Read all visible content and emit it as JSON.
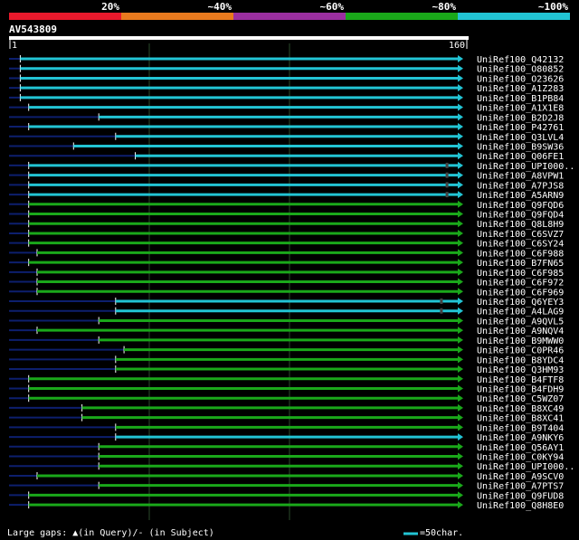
{
  "legend": {
    "bands": [
      {
        "label": "20%",
        "color": "#e8192c"
      },
      {
        "label": "~40%",
        "color": "#e87a1e"
      },
      {
        "label": "~60%",
        "color": "#9b2fa0"
      },
      {
        "label": "~80%",
        "color": "#1aa81a"
      },
      {
        "label": "~100%",
        "color": "#22c4d4"
      }
    ]
  },
  "footer": {
    "gaps_text": "Large gaps: ▲(in Query)/- (in Subject)",
    "scale_text": "=50char."
  },
  "chart_data": {
    "type": "alignment",
    "query_name": "AV543809",
    "query_start": "1",
    "query_end": "160",
    "query_length": 160,
    "colors": {
      "cyan": "#22c4d4",
      "green": "#1aa81a",
      "prefix": "#0d1f6e",
      "grid": "#2a4a2a"
    },
    "hits": [
      {
        "name": "UniRef100_Q42132",
        "start": 4,
        "end": 160,
        "identity": "~100%",
        "gaps": []
      },
      {
        "name": "UniRef100_O80852",
        "start": 4,
        "end": 160,
        "identity": "~100%",
        "gaps": []
      },
      {
        "name": "UniRef100_O23626",
        "start": 4,
        "end": 160,
        "identity": "~100%",
        "gaps": []
      },
      {
        "name": "UniRef100_A1Z283",
        "start": 4,
        "end": 160,
        "identity": "~100%",
        "gaps": []
      },
      {
        "name": "UniRef100_B1PB84",
        "start": 4,
        "end": 160,
        "identity": "~100%",
        "gaps": []
      },
      {
        "name": "UniRef100_A1X1E8",
        "start": 7,
        "end": 160,
        "identity": "~100%",
        "gaps": []
      },
      {
        "name": "UniRef100_B2D2J8",
        "start": 32,
        "end": 160,
        "identity": "~100%",
        "gaps": []
      },
      {
        "name": "UniRef100_P42761",
        "start": 7,
        "end": 160,
        "identity": "~100%",
        "gaps": []
      },
      {
        "name": "UniRef100_Q3LVL4",
        "start": 38,
        "end": 160,
        "identity": "~100%",
        "gaps": []
      },
      {
        "name": "UniRef100_B9SW36",
        "start": 23,
        "end": 160,
        "identity": "~100%",
        "gaps": []
      },
      {
        "name": "UniRef100_Q06FE1",
        "start": 45,
        "end": 160,
        "identity": "~100%",
        "gaps": []
      },
      {
        "name": "UniRef100_UPI000..",
        "start": 7,
        "end": 160,
        "identity": "~100%",
        "gaps": [
          156
        ]
      },
      {
        "name": "UniRef100_A8VPW1",
        "start": 7,
        "end": 160,
        "identity": "~100%",
        "gaps": [
          156
        ]
      },
      {
        "name": "UniRef100_A7PJS8",
        "start": 7,
        "end": 160,
        "identity": "~100%",
        "gaps": [
          156
        ]
      },
      {
        "name": "UniRef100_A5ARN9",
        "start": 7,
        "end": 160,
        "identity": "~100%",
        "gaps": [
          156
        ]
      },
      {
        "name": "UniRef100_Q9FQD6",
        "start": 7,
        "end": 160,
        "identity": "~80%",
        "gaps": []
      },
      {
        "name": "UniRef100_Q9FQD4",
        "start": 7,
        "end": 160,
        "identity": "~80%",
        "gaps": []
      },
      {
        "name": "UniRef100_Q8L8H9",
        "start": 7,
        "end": 160,
        "identity": "~80%",
        "gaps": []
      },
      {
        "name": "UniRef100_C6SVZ7",
        "start": 7,
        "end": 160,
        "identity": "~80%",
        "gaps": []
      },
      {
        "name": "UniRef100_C6SY24",
        "start": 7,
        "end": 160,
        "identity": "~80%",
        "gaps": []
      },
      {
        "name": "UniRef100_C6F988",
        "start": 10,
        "end": 160,
        "identity": "~80%",
        "gaps": []
      },
      {
        "name": "UniRef100_B7FN65",
        "start": 7,
        "end": 160,
        "identity": "~80%",
        "gaps": []
      },
      {
        "name": "UniRef100_C6F985",
        "start": 10,
        "end": 160,
        "identity": "~80%",
        "gaps": []
      },
      {
        "name": "UniRef100_C6F972",
        "start": 10,
        "end": 160,
        "identity": "~80%",
        "gaps": []
      },
      {
        "name": "UniRef100_C6F969",
        "start": 10,
        "end": 160,
        "identity": "~80%",
        "gaps": []
      },
      {
        "name": "UniRef100_Q6YEY3",
        "start": 38,
        "end": 160,
        "identity": "~100%",
        "gaps": [
          154
        ]
      },
      {
        "name": "UniRef100_A4LAG9",
        "start": 38,
        "end": 160,
        "identity": "~100%",
        "gaps": [
          154
        ]
      },
      {
        "name": "UniRef100_A9QVL5",
        "start": 32,
        "end": 160,
        "identity": "~80%",
        "gaps": []
      },
      {
        "name": "UniRef100_A9NQV4",
        "start": 10,
        "end": 160,
        "identity": "~80%",
        "gaps": []
      },
      {
        "name": "UniRef100_B9MWW0",
        "start": 32,
        "end": 160,
        "identity": "~80%",
        "gaps": []
      },
      {
        "name": "UniRef100_C0PR46",
        "start": 41,
        "end": 160,
        "identity": "~80%",
        "gaps": []
      },
      {
        "name": "UniRef100_B8YDC4",
        "start": 38,
        "end": 160,
        "identity": "~80%",
        "gaps": []
      },
      {
        "name": "UniRef100_Q3HM93",
        "start": 38,
        "end": 160,
        "identity": "~80%",
        "gaps": []
      },
      {
        "name": "UniRef100_B4FTF8",
        "start": 7,
        "end": 160,
        "identity": "~80%",
        "gaps": []
      },
      {
        "name": "UniRef100_B4FDH9",
        "start": 7,
        "end": 160,
        "identity": "~80%",
        "gaps": []
      },
      {
        "name": "UniRef100_C5WZ07",
        "start": 7,
        "end": 160,
        "identity": "~80%",
        "gaps": []
      },
      {
        "name": "UniRef100_B8XC49",
        "start": 26,
        "end": 160,
        "identity": "~80%",
        "gaps": []
      },
      {
        "name": "UniRef100_B8XC41",
        "start": 26,
        "end": 160,
        "identity": "~80%",
        "gaps": []
      },
      {
        "name": "UniRef100_B9T404",
        "start": 38,
        "end": 160,
        "identity": "~80%",
        "gaps": []
      },
      {
        "name": "UniRef100_A9NKY6",
        "start": 38,
        "end": 160,
        "identity": "~100%",
        "gaps": []
      },
      {
        "name": "UniRef100_Q56AY1",
        "start": 32,
        "end": 160,
        "identity": "~80%",
        "gaps": []
      },
      {
        "name": "UniRef100_C0KY94",
        "start": 32,
        "end": 160,
        "identity": "~80%",
        "gaps": []
      },
      {
        "name": "UniRef100_UPI000..",
        "start": 32,
        "end": 160,
        "identity": "~80%",
        "gaps": []
      },
      {
        "name": "UniRef100_A9SCV0",
        "start": 10,
        "end": 160,
        "identity": "~80%",
        "gaps": []
      },
      {
        "name": "UniRef100_A7PTS7",
        "start": 32,
        "end": 160,
        "identity": "~80%",
        "gaps": []
      },
      {
        "name": "UniRef100_Q9FUD8",
        "start": 7,
        "end": 160,
        "identity": "~80%",
        "gaps": []
      },
      {
        "name": "UniRef100_Q8H8E0",
        "start": 7,
        "end": 160,
        "identity": "~80%",
        "gaps": []
      }
    ]
  }
}
